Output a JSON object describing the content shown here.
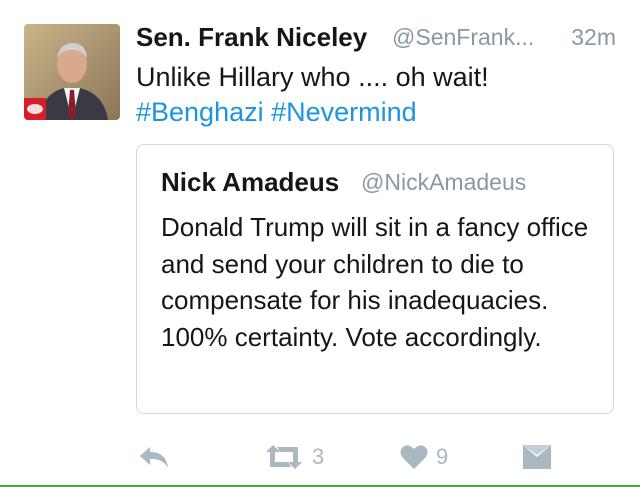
{
  "tweet": {
    "author_name": "Sen. Frank Niceley",
    "author_handle": "@SenFrank...",
    "time": "32m",
    "text": "Unlike Hillary who .... oh wait!",
    "hashtag_1": "#Benghazi",
    "hashtag_2": "#Nevermind"
  },
  "quoted_tweet": {
    "author_name": "Nick Amadeus",
    "author_handle": "@NickAmadeus",
    "text": "Donald Trump will sit in a fancy office and send your children to die to compensate for his inadequacies. 100% certainty. Vote accordingly."
  },
  "actions": {
    "retweet_count": "3",
    "like_count": "9"
  },
  "icons": {
    "reply": "reply-icon",
    "retweet": "retweet-icon",
    "like": "heart-icon",
    "message": "direct-message-icon"
  },
  "colors": {
    "hashtag": "#1b95e0",
    "muted": "#8899a6",
    "action_icon": "#aab8c2",
    "quote_border": "#cfd9de"
  }
}
